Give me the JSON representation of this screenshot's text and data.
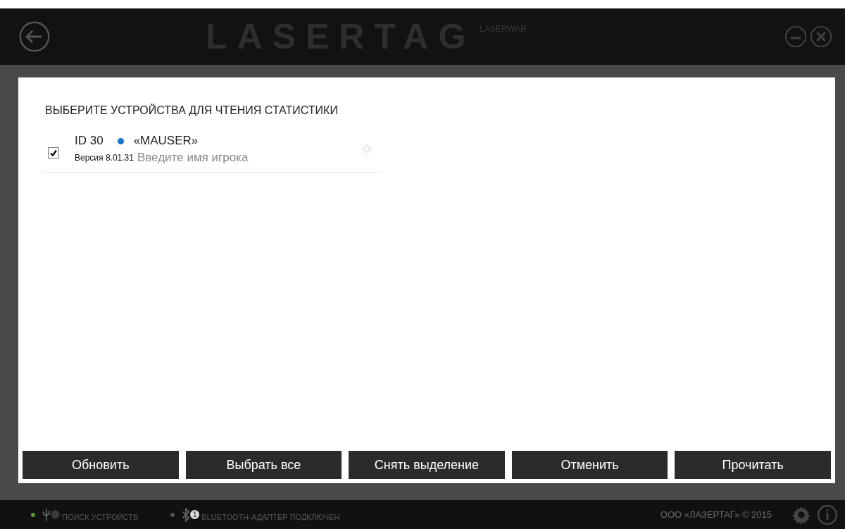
{
  "header": {
    "logo": "LASERTAG",
    "brand": "LASERWAR"
  },
  "dialog": {
    "title": "ВЫБЕРИТЕ УСТРОЙСТВА ДЛЯ ЧТЕНИЯ СТАТИСТИКИ",
    "devices": [
      {
        "id": "ID 30",
        "color": "#1a73c8",
        "name": "«MAUSER»",
        "version": "Версия 8.01.31",
        "placeholder": "Введите имя игрока",
        "checked": true
      }
    ],
    "buttons": [
      "Обновить",
      "Выбрать все",
      "Снять выделение",
      "Отменить",
      "Прочитать"
    ]
  },
  "status_bar": {
    "items": [
      {
        "kind": "usb",
        "color": "#5a9a2a",
        "count": "0",
        "label": "ПОИСК УСТРОЙСТВ"
      },
      {
        "kind": "bluetooth",
        "color": "#555555",
        "count": "1",
        "label": "BLUETOOTH-АДАПТЕР ПОДКЛЮЧЕН"
      }
    ],
    "copyright": "ООО «ЛАЗЕРТАГ» © 2015"
  }
}
